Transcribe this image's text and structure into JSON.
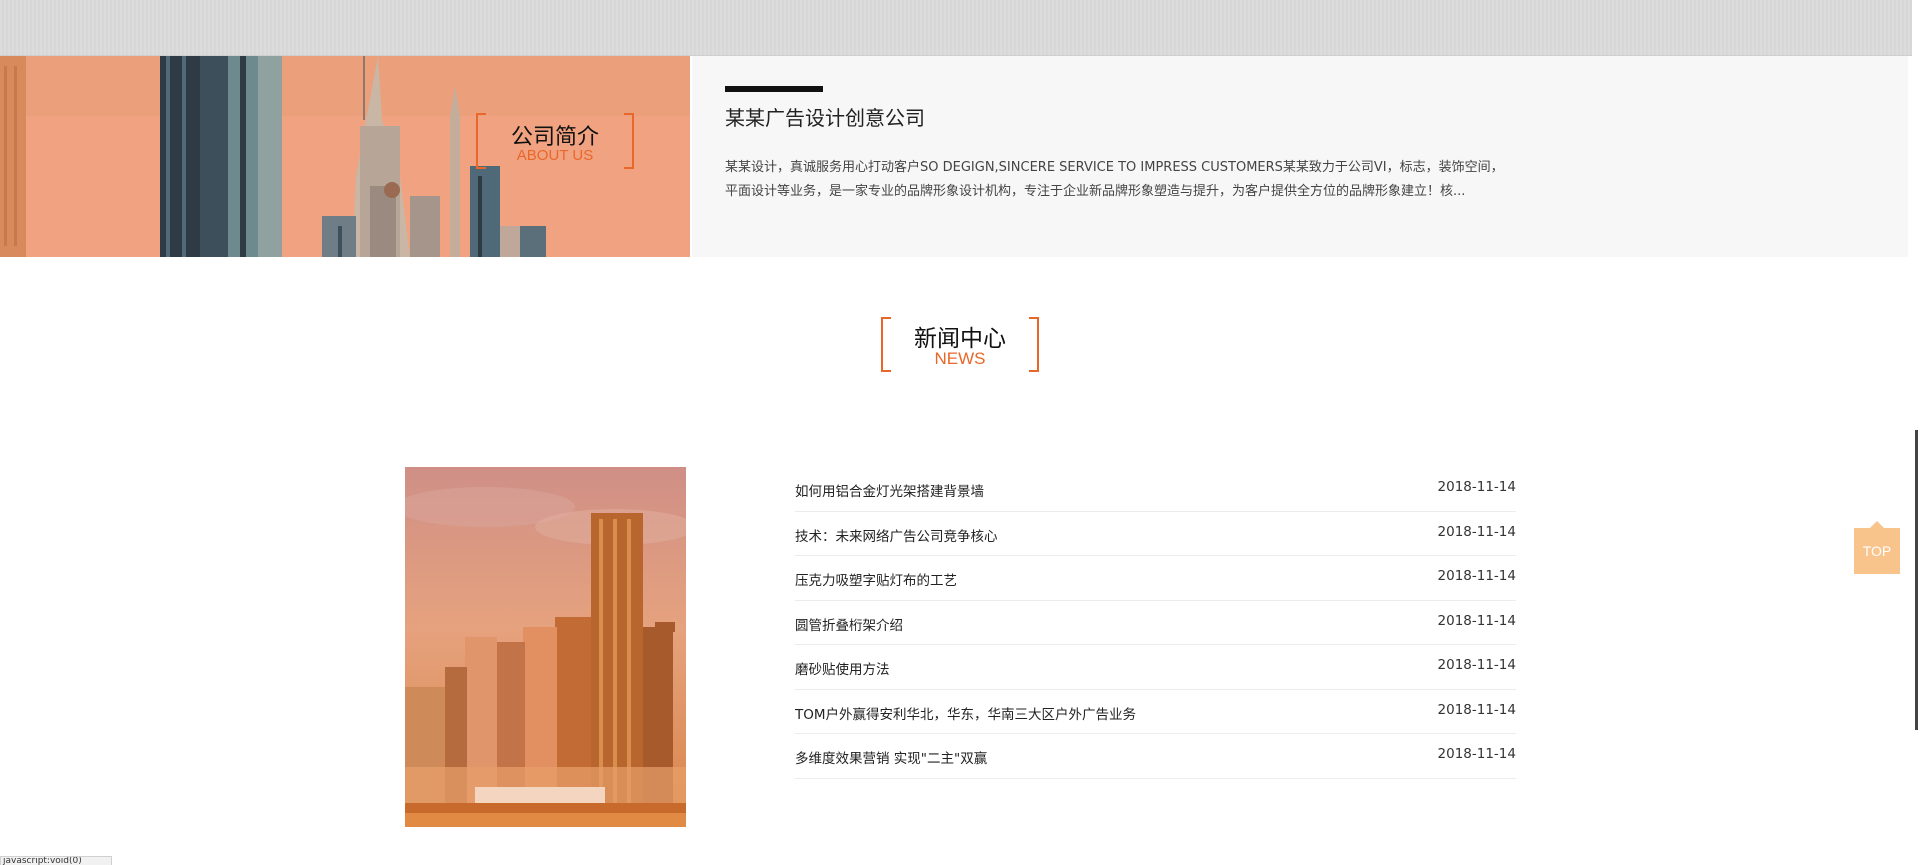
{
  "about": {
    "section_title": "公司简介",
    "section_title_en": "ABOUT US",
    "heading": "某某广告设计创意公司",
    "description": "某某设计，真诚服务用心打动客户SO DEGIGN,SINCERE SERVICE TO IMPRESS CUSTOMERS某某致力于公司VI，标志，装饰空间，平面设计等业务，是一家专业的品牌形象设计机构，专注于企业新品牌形象塑造与提升，为客户提供全方位的品牌形象建立！核..."
  },
  "news": {
    "section_title": "新闻中心",
    "section_title_en": "NEWS",
    "items": [
      {
        "title": "如何用铝合金灯光架搭建背景墙",
        "date": "2018-11-14"
      },
      {
        "title": "技术：未来网络广告公司竞争核心",
        "date": "2018-11-14"
      },
      {
        "title": "压克力吸塑字贴灯布的工艺",
        "date": "2018-11-14"
      },
      {
        "title": "圆管折叠桁架介绍",
        "date": "2018-11-14"
      },
      {
        "title": "磨砂贴使用方法",
        "date": "2018-11-14"
      },
      {
        "title": "TOM户外赢得安利华北，华东，华南三大区户外广告业务",
        "date": "2018-11-14"
      },
      {
        "title": "多维度效果营销 实现\"二主\"双赢",
        "date": "2018-11-14"
      }
    ]
  },
  "top_button": {
    "label": "TOP"
  },
  "status_tip": {
    "text": "javascript:void(0)"
  },
  "colors": {
    "accent": "#e8672a",
    "top_button": "#f8c48c"
  }
}
